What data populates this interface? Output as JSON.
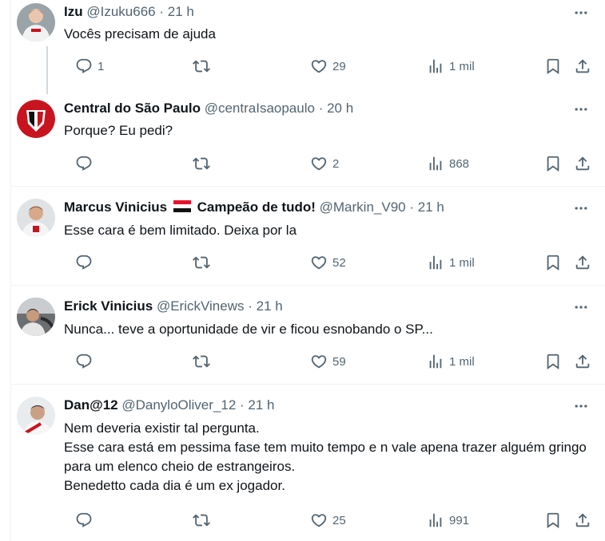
{
  "tweets": [
    {
      "name": "Izu",
      "handle": "@Izuku666",
      "dot": "·",
      "time": "21 h",
      "text": "Vocês precisam de ajuda",
      "replies": "1",
      "retweets": "",
      "likes": "29",
      "views": "1 mil"
    },
    {
      "name": "Central do São Paulo",
      "handle": "@centraIsaopaulo",
      "dot": "·",
      "time": "20 h",
      "text": "Porque? Eu pedi?",
      "replies": "",
      "retweets": "",
      "likes": "2",
      "views": "868"
    },
    {
      "name": "Marcus Vinicius",
      "name_suffix": "Campeão de tudo!",
      "handle": "@Markin_V90",
      "dot": "·",
      "time": "21 h",
      "text": "Esse cara é bem limitado. Deixa por la",
      "replies": "",
      "retweets": "",
      "likes": "52",
      "views": "1 mil"
    },
    {
      "name": "Erick Vinicius",
      "handle": "@ErickVinews",
      "dot": "·",
      "time": "21 h",
      "text": "Nunca... teve a oportunidade de vir e ficou esnobando o SP...",
      "replies": "",
      "retweets": "",
      "likes": "59",
      "views": "1 mil"
    },
    {
      "name": "Dan@12",
      "handle": "@DanyloOliver_12",
      "dot": "·",
      "time": "21 h",
      "text": "Nem deveria existir tal pergunta.\nEsse cara está em pessima fase tem muito tempo e n vale apena trazer alguém gringo para um elenco cheio de estrangeiros.\nBenedetto cada dia é um ex jogador.",
      "replies": "",
      "retweets": "",
      "likes": "25",
      "views": "991"
    }
  ],
  "icons": {
    "reply": "reply-icon",
    "retweet": "retweet-icon",
    "like": "heart-icon",
    "views": "views-icon",
    "bookmark": "bookmark-icon",
    "share": "share-icon",
    "more": "more-icon",
    "flag": "flag-icon"
  },
  "colors": {
    "text": "#0f1419",
    "secondary": "#536471",
    "divider": "#eff3f4",
    "thread": "#cfd9de"
  }
}
